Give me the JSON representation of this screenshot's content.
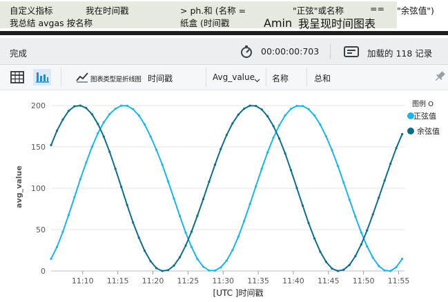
{
  "query": {
    "line1_a": "自定义指标",
    "line1_b": "我在时间戳",
    "line1_c": "> ph.和 (名称 =",
    "line1_d": "\"正弦\"或名称",
    "line1_e": "==",
    "line1_f": "\"余弦值\")",
    "line2_a": "我总结 avgas 按名称",
    "line2_b": "纸盒 (时间戳",
    "line2_c": "Amin",
    "line2_d": "我呈现时间图表"
  },
  "status": {
    "done_label": "完成",
    "elapsed": "00:00:00:703",
    "records_loaded": "加载的 118 记录"
  },
  "toolbar": {
    "chart_type_label": "图表类型是折线图",
    "x_column": "时间戳",
    "y_column": "Avg_value",
    "series_column": "名称",
    "aggregation": "总和"
  },
  "colors": {
    "sine": "#1ab6e8",
    "cosine": "#0b6e86",
    "grid": "#e6e6e6"
  },
  "chart_data": {
    "type": "line",
    "xlabel": "[UTC ]时间戳",
    "ylabel": "avg_value",
    "ylim": [
      0,
      200
    ],
    "yticks": [
      0,
      50,
      100,
      150,
      200
    ],
    "xlim": [
      "11:05:30",
      "11:55:50"
    ],
    "xticks": [
      "11:10",
      "11:15",
      "11:20",
      "11:25",
      "11:30",
      "11:35",
      "11:40",
      "11:45",
      "11:50",
      "11:55"
    ],
    "legend_title": "图例 O",
    "legend_position": "top-right",
    "series": [
      {
        "name": "正弦值",
        "color": "#1ab6e8",
        "function": "100 + 100*sin(2*pi*(t - t0)/period)",
        "period_minutes": 20.2,
        "start": "11:05:30",
        "step_seconds": 50,
        "values": [
          14.7,
          29.0,
          47.2,
          67.7,
          89.2,
          111.0,
          131.2,
          150.0,
          166.3,
          179.7,
          189.6,
          196.0,
          199.8,
          199.7,
          195.5,
          188.0,
          177.0,
          162.6,
          146.3,
          128.4,
          108.3,
          87.5,
          66.4,
          46.3,
          29.0,
          14.6,
          5.2,
          0.6,
          0.4,
          4.3,
          12.5,
          25.1,
          41.4,
          60.4,
          81.1,
          102.4,
          123.6,
          143.3,
          161.1,
          176.0,
          188.0,
          196.0,
          199.5,
          199.4,
          195.6,
          188.0,
          176.9,
          162.7,
          145.9,
          127.0,
          106.8,
          86.1,
          65.7,
          46.6,
          29.8,
          16.0,
          6.1,
          0.6,
          0.0,
          4.6,
          14.7
        ]
      },
      {
        "name": "余弦值",
        "color": "#0b6e86",
        "function": "100 + 100*cos(2*pi*(t - t0)/period)",
        "period_minutes": 20.2,
        "start": "11:05:30",
        "step_seconds": 50,
        "values": [
          152.1,
          169.4,
          183.0,
          193.4,
          199.1,
          199.9,
          196.9,
          189.4,
          177.7,
          162.4,
          143.9,
          123.4,
          101.6,
          79.7,
          58.7,
          40.3,
          24.3,
          11.8,
          3.3,
          0.0,
          1.0,
          6.6,
          16.6,
          30.7,
          47.4,
          66.6,
          86.8,
          107.8,
          128.3,
          147.4,
          164.3,
          178.3,
          189.0,
          196.2,
          199.8,
          199.5,
          195.2,
          187.0,
          175.1,
          160.0,
          142.0,
          121.8,
          100.3,
          78.9,
          58.0,
          39.4,
          23.3,
          11.0,
          2.9,
          0.0,
          1.5,
          7.3,
          17.9,
          32.0,
          49.0,
          68.3,
          88.6,
          109.3,
          129.7,
          148.6,
          165.4
        ]
      }
    ]
  }
}
